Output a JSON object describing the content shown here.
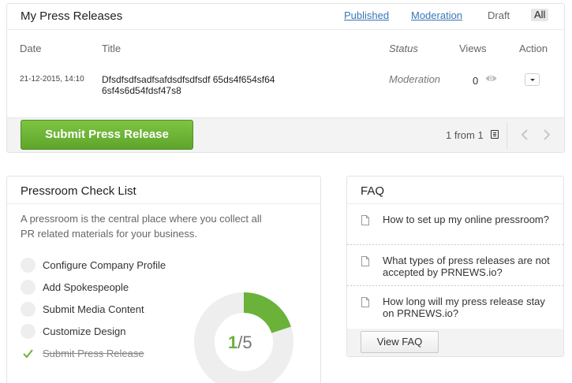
{
  "press_releases": {
    "title": "My Press Releases",
    "tabs": [
      {
        "label": "Published"
      },
      {
        "label": "Moderation"
      },
      {
        "label": "Draft"
      },
      {
        "label": "All"
      }
    ],
    "columns": {
      "date": "Date",
      "title": "Title",
      "status": "Status",
      "views": "Views",
      "action": "Action"
    },
    "rows": [
      {
        "date": "21-12-2015, 14:10",
        "title": "Dfsdfsdfsadfsafdsdfsdfsdf 65ds4f654sf64 6sf4s6d54fdsf47s8",
        "status": "Moderation",
        "views": "0"
      }
    ],
    "submit_label": "Submit Press Release",
    "pager": "1 from 1"
  },
  "checklist": {
    "title": "Pressroom Check List",
    "description": "A pressroom is the central place where you collect all PR related materials for your business.",
    "items": [
      {
        "label": "Configure Company Profile",
        "done": false
      },
      {
        "label": "Add Spokespeople",
        "done": false
      },
      {
        "label": "Submit Media Content",
        "done": false
      },
      {
        "label": "Customize Design",
        "done": false
      },
      {
        "label": "Submit Press Release",
        "done": true
      }
    ],
    "progress": {
      "done": "1",
      "total": "/5",
      "fraction": 0.2
    },
    "colors": {
      "accent": "#6ab23a",
      "track": "#eeeeee"
    }
  },
  "faq": {
    "title": "FAQ",
    "items": [
      {
        "question": "How to set up my online pressroom?"
      },
      {
        "question": "What types of press releases are not accepted by PRNEWS.io?"
      },
      {
        "question": "How long will my press release stay on PRNEWS.io?"
      }
    ],
    "button_label": "View FAQ"
  }
}
